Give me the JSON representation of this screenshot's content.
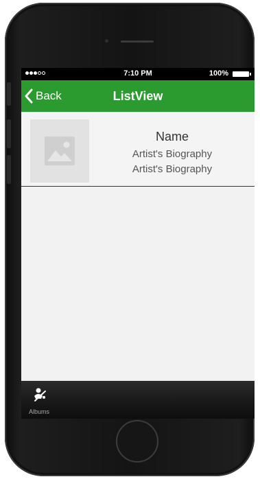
{
  "status_bar": {
    "time": "7:10 PM",
    "battery": "100%",
    "signal_dots_filled": 3,
    "signal_dots_total": 5
  },
  "nav": {
    "back_label": "Back",
    "title": "ListView"
  },
  "list": {
    "items": [
      {
        "name": "Name",
        "bio_line1": "Artist's Biography",
        "bio_line2": "Artist's Biography",
        "thumbnail_icon": "image-placeholder-icon"
      }
    ]
  },
  "tab_bar": {
    "tabs": [
      {
        "label": "Albums",
        "icon": "albums-icon"
      }
    ]
  },
  "colors": {
    "nav_green": "#2b9a2f",
    "screen_bg": "#f2f2f2",
    "tab_bar": "#1c1c1c"
  }
}
